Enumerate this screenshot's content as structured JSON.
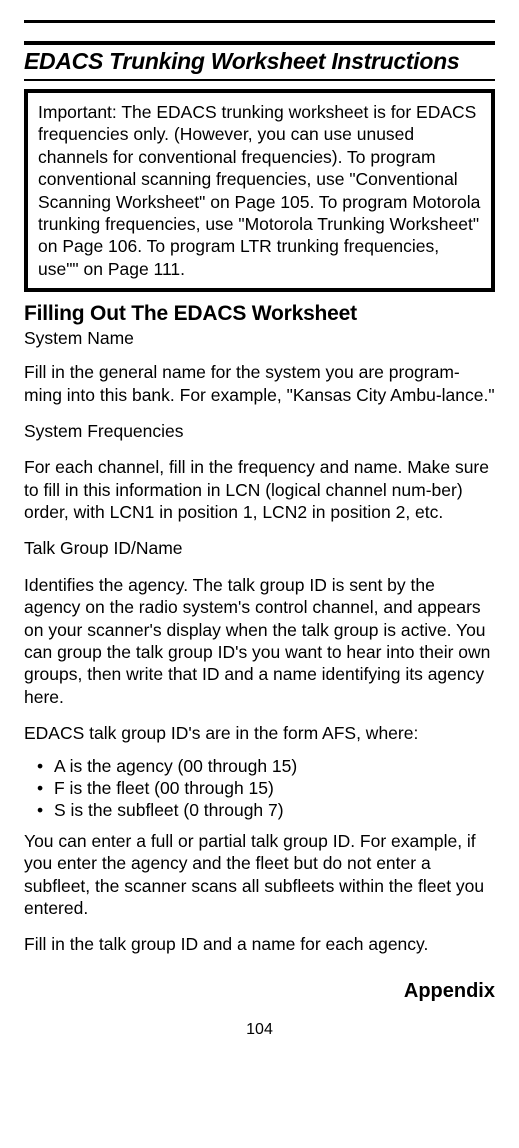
{
  "title": "EDACS Trunking Worksheet Instructions",
  "important_box": "Important: The EDACS trunking worksheet is for EDACS frequencies only.  (However, you can use unused channels for conventional frequencies). To program conventional scanning frequencies, use \"Conventional Scanning Worksheet\" on Page 105. To program Motorola trunking frequencies, use \"Motorola Trunking Worksheet\" on Page 106. To program LTR trunking frequencies, use\"\" on Page 111.",
  "subheading": "Filling Out The EDACS Worksheet",
  "sections": {
    "system_name": {
      "label": "System Name",
      "text": "Fill in the general name for the system you are program-ming into this bank. For example, \"Kansas City Ambu-lance.\""
    },
    "system_frequencies": {
      "label": "System Frequencies",
      "text": "For each channel, fill in the frequency and name. Make sure to fill in this information in LCN (logical channel num-ber) order, with LCN1 in position 1, LCN2 in position 2, etc."
    },
    "talk_group": {
      "label": "Talk Group ID/Name",
      "text": "Identifies the agency. The talk group ID is sent by the agency on the radio system's control channel, and appears on your scanner's display when the talk group is active.  You can group the talk group ID's you want to hear into their own groups, then write that ID and a name identifying its agency here."
    }
  },
  "afs_intro": "EDACS talk group ID's are in the form AFS, where:",
  "afs_bullets": [
    "A is the agency (00 through 15)",
    "F is the fleet (00 through 15)",
    "S is the subfleet (0 through 7)"
  ],
  "partial_para": "You can enter a full or partial talk group ID. For example, if you enter the agency and the fleet but do not enter a subfleet, the scanner scans all subfleets within the fleet you entered.",
  "fill_para": "Fill in the talk group ID and a name for each agency.",
  "appendix": "Appendix",
  "page_number": "104"
}
